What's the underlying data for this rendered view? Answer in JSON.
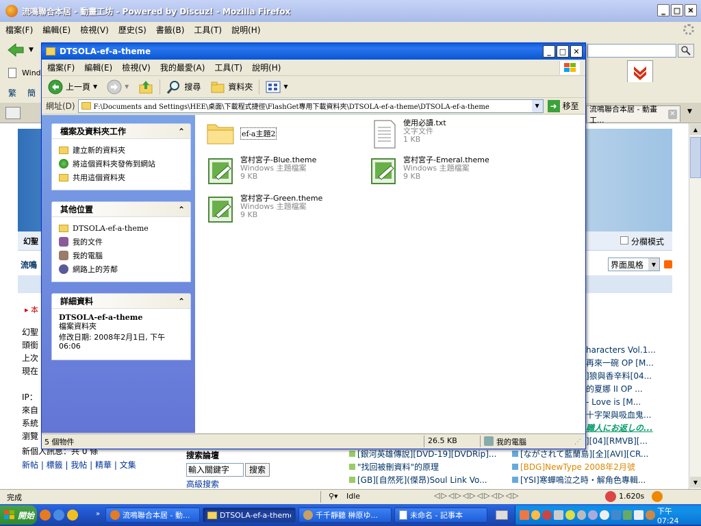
{
  "firefox": {
    "title": "流鳴聯合本居 - 動畫工坊 - Powered by Discuz! - Mozilla Firefox",
    "menu": [
      "檔案(F)",
      "編輯(E)",
      "檢視(V)",
      "歷史(S)",
      "書籤(B)",
      "工具(T)",
      "說明(H)"
    ],
    "bookmark_partial": "Wind",
    "bookmark_chars": [
      "繁",
      "簡"
    ],
    "tab_label": "流鳴聯合本居 - 動畫工...",
    "page_right_links": [
      "haracters Vol.1...",
      "再來一碗 OP [M...",
      "]狼與香辛料[04...",
      "的夏娜 II OP ...",
      "- Love is [M...",
      "十字架與吸血鬼...",
      "職人にお返しの...",
      "][04][RMVB][..."
    ],
    "split_mode_label": "分欄模式",
    "style_select": "界面風格",
    "side_text_1": "幻聖",
    "side_text_2": "流鳴",
    "side_text_3": "本",
    "left_lines": [
      "幻聖",
      "頭銜",
      "上次",
      "現在",
      "IP：",
      "來自",
      "系統",
      "瀏覽"
    ],
    "new_pm_line": "新個人訊息：共 0 條",
    "bottom_links": "新帖 | 標籤 | 我帖 | 精華 | 文集",
    "search_title": "搜索論壇",
    "search_input": "輸入關鍵字",
    "search_button": "搜索",
    "adv_search": "高級搜索",
    "bottom_threads": [
      "[銀河英雄傳說][DVD-19][DVDRip]...",
      "\"找回被刪資料\"的原理",
      "[GB][自然死](傑昂)Soul Link Vo...",
      "[ながされて藍蘭島][全][AVI][CR...",
      "[BDG]NewType 2008年2月號",
      "[YSI]寒蟬鳴泣之時・解角色專輯..."
    ],
    "status_text": "完成",
    "status_idle": "Idle",
    "status_time": "1.620s"
  },
  "explorer": {
    "title": "DTSOLA-ef-a-theme",
    "menu": [
      "檔案(F)",
      "編輯(E)",
      "檢視(V)",
      "我的最愛(A)",
      "工具(T)",
      "說明(H)"
    ],
    "back_label": "上一頁",
    "search_label": "搜尋",
    "folders_label": "資料夾",
    "address_label": "網址(D)",
    "address_value": "F:\\Documents and Settings\\HEE\\桌面\\下載程式捷徑\\FlashGet專用下載資料夾\\DTSOLA-ef-a-theme\\DTSOLA-ef-a-theme",
    "go_label": "移至",
    "tasks_title": "檔案及資料夾工作",
    "tasks": [
      "建立新的資料夾",
      "將這個資料夾發佈到網站",
      "共用這個資料夾"
    ],
    "places_title": "其他位置",
    "places": [
      "DTSOLA-ef-a-theme",
      "我的文件",
      "我的電腦",
      "網路上的芳鄰"
    ],
    "details_title": "詳細資料",
    "details_name": "DTSOLA-ef-a-theme",
    "details_type": "檔案資料夾",
    "details_date": "修改日期: 2008年2月1日, 下午 06:06",
    "files": [
      {
        "name": "ef-a主題2",
        "type": "",
        "size": ""
      },
      {
        "name": "使用必讀.txt",
        "type": "文字文件",
        "size": "1 KB"
      },
      {
        "name": "宮村宮子-Blue.theme",
        "type": "Windows 主題檔案",
        "size": "9 KB"
      },
      {
        "name": "宮村宮子-Emeral.theme",
        "type": "Windows 主題檔案",
        "size": "9 KB"
      },
      {
        "name": "宮村宮子-Green.theme",
        "type": "Windows 主題檔案",
        "size": "9 KB"
      }
    ],
    "status_count": "5 個物件",
    "status_size": "26.5 KB",
    "status_location": "我的電腦"
  },
  "taskbar": {
    "start": "開始",
    "buttons": [
      "流鳴聯合本居 - 動...",
      "DTSOLA-ef-a-theme",
      "千千靜聽 榊原ゆ...",
      "未命名 - 記事本"
    ],
    "clock": "下午 07:24"
  }
}
